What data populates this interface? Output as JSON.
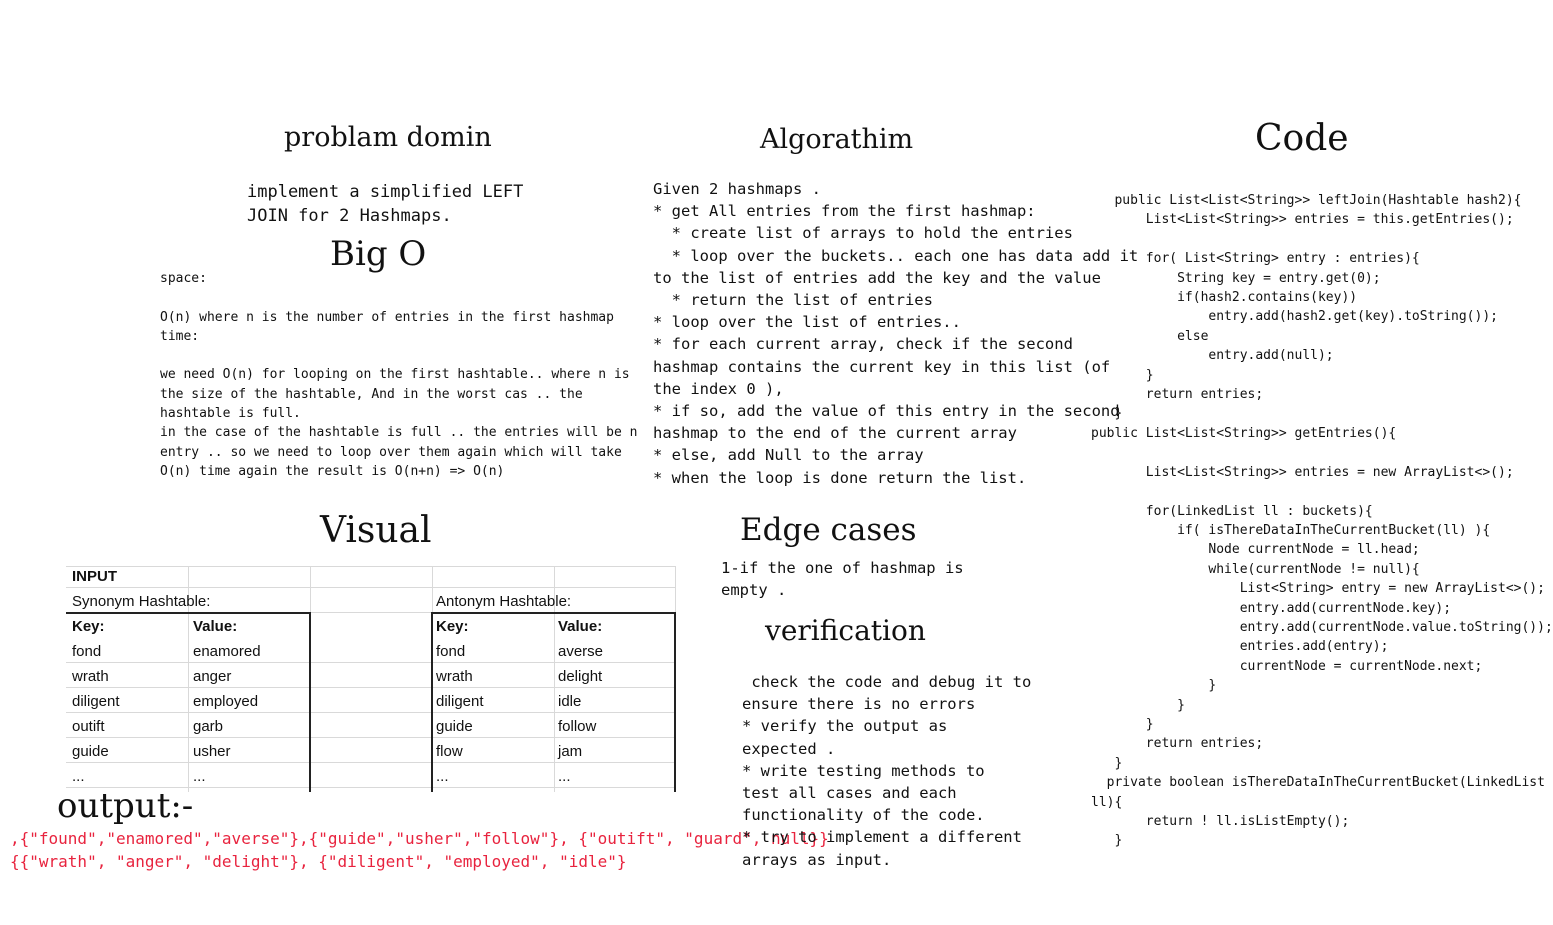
{
  "problem": {
    "title": "problam domin",
    "description": "implement a simplified LEFT\nJOIN for 2 Hashmaps."
  },
  "big_o": {
    "title": "Big O",
    "text": "space:\n\nO(n) where n is the number of entries in the first hashmap\ntime:\n\nwe need O(n) for looping on the first hashtable.. where n is\nthe size of the hashtable, And in the worst cas .. the\nhashtable is full.\nin the case of the hashtable is full .. the entries will be n\nentry .. so we need to loop over them again which will take\nO(n) time again the result is O(n+n) => O(n)"
  },
  "algorithm": {
    "title": "Algorathim",
    "text": "Given 2 hashmaps .\n* get All entries from the first hashmap:\n  * create list of arrays to hold the entries\n  * loop over the buckets.. each one has data add it\nto the list of entries add the key and the value\n  * return the list of entries\n* loop over the list of entries..\n* for each current array, check if the second\nhashmap contains the current key in this list (of\nthe index 0 ),\n* if so, add the value of this entry in the second\nhashmap to the end of the current array\n* else, add Null to the array\n* when the loop is done return the list."
  },
  "code": {
    "title": "Code",
    "text": "   public List<List<String>> leftJoin(Hashtable hash2){\n       List<List<String>> entries = this.getEntries();\n\n       for( List<String> entry : entries){\n           String key = entry.get(0);\n           if(hash2.contains(key))\n               entry.add(hash2.get(key).toString());\n           else\n               entry.add(null);\n       }\n       return entries;\n   }\npublic List<List<String>> getEntries(){\n\n       List<List<String>> entries = new ArrayList<>();\n\n       for(LinkedList ll : buckets){\n           if( isThereDataInTheCurrentBucket(ll) ){\n               Node currentNode = ll.head;\n               while(currentNode != null){\n                   List<String> entry = new ArrayList<>();\n                   entry.add(currentNode.key);\n                   entry.add(currentNode.value.toString());\n                   entries.add(entry);\n                   currentNode = currentNode.next;\n               }\n           }\n       }\n       return entries;\n   }\n  private boolean isThereDataInTheCurrentBucket(LinkedList\nll){\n       return ! ll.isListEmpty();\n   }"
  },
  "visual": {
    "title": "Visual",
    "input_label": "INPUT",
    "synonym": {
      "caption": "Synonym Hashtable:",
      "headers": [
        "Key:",
        "Value:"
      ],
      "rows": [
        [
          "fond",
          "enamored"
        ],
        [
          "wrath",
          "anger"
        ],
        [
          "diligent",
          "employed"
        ],
        [
          "outift",
          "garb"
        ],
        [
          "guide",
          "usher"
        ],
        [
          "...",
          "..."
        ]
      ]
    },
    "antonym": {
      "caption": "Antonym Hashtable:",
      "headers": [
        "Key:",
        "Value:"
      ],
      "rows": [
        [
          "fond",
          "averse"
        ],
        [
          "wrath",
          "delight"
        ],
        [
          "diligent",
          "idle"
        ],
        [
          "guide",
          "follow"
        ],
        [
          "flow",
          "jam"
        ],
        [
          "...",
          "..."
        ]
      ]
    },
    "output_title": "output:-",
    "output_text": ",{\"found\",\"enamored\",\"averse\"},{\"guide\",\"usher\",\"follow\"}, {\"outift\", \"guard\", null}}\n{{\"wrath\", \"anger\", \"delight\"}, {\"diligent\", \"employed\", \"idle\"}",
    "output_color": "#e8233e"
  },
  "edge_cases": {
    "title": "Edge cases",
    "text": "1-if the one of hashmap is\nempty ."
  },
  "verification": {
    "title": "verification",
    "text": " check the code and debug it to\nensure there is no errors\n* verify the output as\nexpected .\n* write testing methods to\ntest all cases and each\nfunctionality of the code.\n* try to implement a different\narrays as input."
  }
}
